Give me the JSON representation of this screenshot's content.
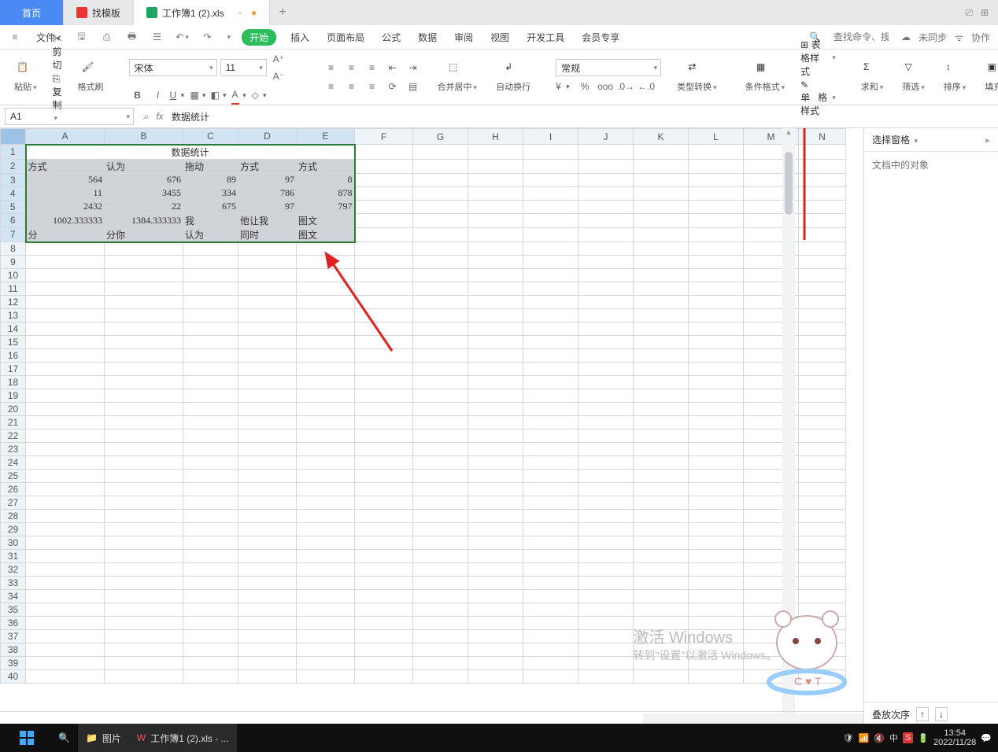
{
  "tabs": {
    "home": "首页",
    "find_template": "找模板",
    "workbook": "工作簿1 (2).xls"
  },
  "menubar": {
    "file": "文件",
    "start": "开始",
    "insert": "插入",
    "layout": "页面布局",
    "formula": "公式",
    "data": "数据",
    "review": "审阅",
    "view": "视图",
    "dev": "开发工具",
    "vip": "会员专享",
    "search_cmd": "查找命令、搜索模板",
    "sync": "未同步",
    "collab": "协作"
  },
  "ribbon": {
    "paste": "粘贴",
    "cut": "剪切",
    "copy": "复制",
    "format_painter": "格式刷",
    "font": "宋体",
    "size": "11",
    "merge": "合并居中",
    "wrap": "自动换行",
    "number_fmt": "常规",
    "type_convert": "类型转换",
    "cond": "条件格式",
    "table_style": "表格样式",
    "cell_style": "格样式",
    "cell_style_prefix": "单",
    "sum": "求和",
    "filter": "筛选",
    "sort": "排序",
    "fill": "填充"
  },
  "namebox": "A1",
  "cell_value": "数据统计",
  "fx_search": "⌕",
  "columns": [
    "A",
    "B",
    "C",
    "D",
    "E",
    "F",
    "G",
    "H",
    "I",
    "J",
    "K",
    "L",
    "M",
    "N"
  ],
  "rows": 40,
  "sel": {
    "r1": 1,
    "c1": 1,
    "r2": 7,
    "c2": 5
  },
  "data": {
    "1": {
      "A": "数据统计",
      "merge": 5
    },
    "2": {
      "A": "方式",
      "B": "认为",
      "C": "拖动",
      "D": "方式",
      "E": "方式"
    },
    "3": {
      "A": "564",
      "B": "676",
      "C": "89",
      "D": "97",
      "E": "8"
    },
    "4": {
      "A": "11",
      "B": "3455",
      "C": "334",
      "D": "786",
      "E": "878"
    },
    "5": {
      "A": "2432",
      "B": "22",
      "C": "675",
      "D": "97",
      "E": "797"
    },
    "6": {
      "A": "1002.333333",
      "B": "1384.333333",
      "C": "我",
      "D": "他让我",
      "E": "图文"
    },
    "7": {
      "A": "分",
      "B": "分你",
      "C": "认为",
      "D": "同时",
      "E": "图文"
    }
  },
  "numeric_rows": [
    "3",
    "4",
    "5"
  ],
  "row6_numeric": [
    "A",
    "B"
  ],
  "panel": {
    "select": "选择窗格",
    "objects": "文档中的对象",
    "stack": "叠放次序"
  },
  "watermark": {
    "l1": "激活 Windows",
    "l2": "转到\"设置\"以激活 Windows。"
  },
  "taskbar": {
    "pictures": "图片",
    "workbook": "工作簿1 (2).xls - ...",
    "time": "13:54",
    "date": "2022/11/28"
  }
}
